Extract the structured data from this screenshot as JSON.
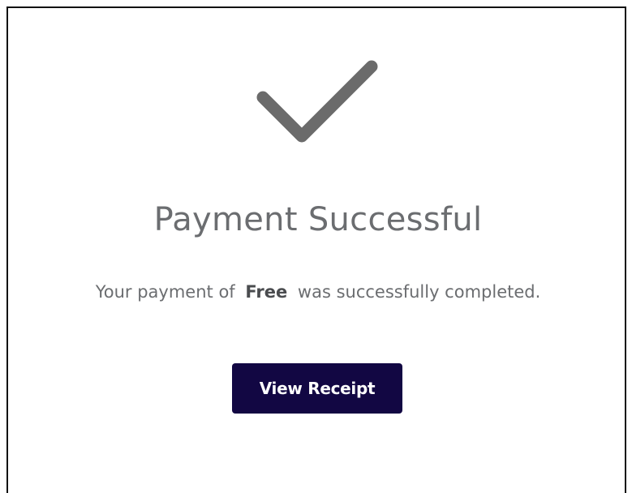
{
  "title": "Payment Successful",
  "message": {
    "prefix": "Your payment of",
    "amount": "Free",
    "suffix": "was successfully completed."
  },
  "button": {
    "label": "View Receipt"
  },
  "icon": {
    "name": "checkmark-icon",
    "color": "#6b6b6b"
  },
  "colors": {
    "text": "#6b6d70",
    "button_bg": "#120743",
    "button_text": "#ffffff",
    "border": "#111111"
  }
}
